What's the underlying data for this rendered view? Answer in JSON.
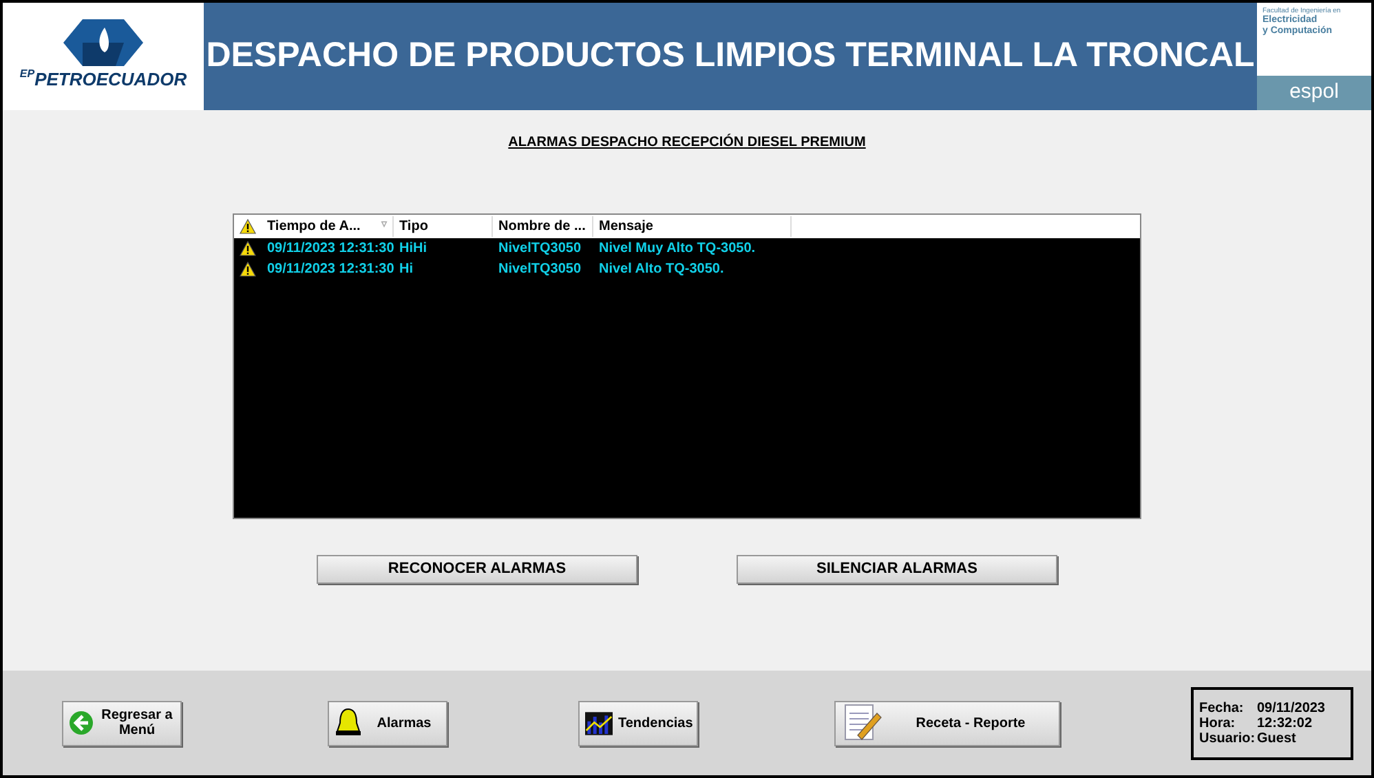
{
  "header": {
    "logo_prefix": "EP",
    "logo_text": "PETROECUADOR",
    "title": "DESPACHO DE PRODUCTOS LIMPIOS TERMINAL LA TRONCAL",
    "faculty_lines": [
      "Facultad de Ingeniería en",
      "Electricidad",
      "y Computación"
    ],
    "university": "espol"
  },
  "section_title": "ALARMAS DESPACHO RECEPCIÓN DIESEL PREMIUM",
  "table": {
    "sort_indicator": "▿",
    "columns": [
      "Tiempo de A...",
      "Tipo",
      "Nombre de ...",
      "Mensaje"
    ],
    "rows": [
      {
        "cells": [
          "09/11/2023 12:31:30",
          "HiHi",
          "NivelTQ3050",
          "Nivel Muy Alto TQ-3050."
        ]
      },
      {
        "cells": [
          "09/11/2023 12:31:30",
          "Hi",
          "NivelTQ3050",
          "Nivel Alto TQ-3050."
        ]
      }
    ]
  },
  "actions": [
    "RECONOCER ALARMAS",
    "SILENCIAR ALARMAS"
  ],
  "nav": [
    {
      "kind": "back",
      "label": "Regresar a Menú"
    },
    {
      "kind": "bell",
      "label": "Alarmas"
    },
    {
      "kind": "chart",
      "label": "Tendencias"
    },
    {
      "kind": "note",
      "label": "Receta - Reporte"
    }
  ],
  "info": [
    {
      "label": "Fecha:",
      "value": "09/11/2023"
    },
    {
      "label": "Hora:",
      "value": "12:32:02"
    },
    {
      "label": "Usuario:",
      "value": "Guest"
    }
  ]
}
